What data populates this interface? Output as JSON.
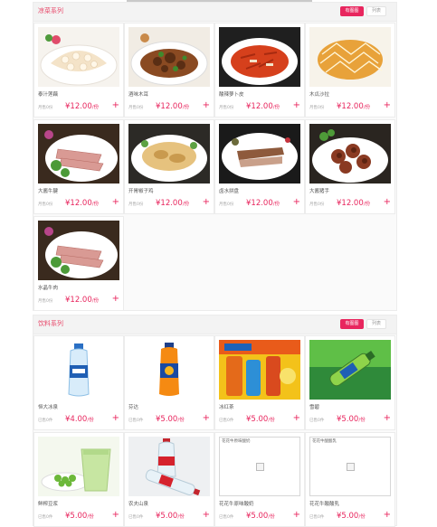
{
  "sections": [
    {
      "title": "凉菜系列",
      "view_image_label": "有图图",
      "view_list_label": "列表",
      "items": [
        {
          "name": "泰汁莲藕",
          "meta": "月售0份",
          "price": "¥12.00",
          "unit": "/份",
          "add": "+",
          "image": "lotus-root-dish"
        },
        {
          "name": "酒味木耳",
          "meta": "月售0份",
          "price": "¥12.00",
          "unit": "/份",
          "add": "+",
          "image": "braised-meat-dish"
        },
        {
          "name": "酸辣萝卜皮",
          "meta": "月售0份",
          "price": "¥12.00",
          "unit": "/份",
          "add": "+",
          "image": "spicy-radish-dish"
        },
        {
          "name": "木瓜沙拉",
          "meta": "月售0份",
          "price": "¥12.00",
          "unit": "/份",
          "add": "+",
          "image": "bread-dish"
        },
        {
          "name": "大酱牛腱",
          "meta": "月售0份",
          "price": "¥12.00",
          "unit": "/份",
          "add": "+",
          "image": "beef-shank-dish"
        },
        {
          "name": "开胃椒子鸡",
          "meta": "月售0份",
          "price": "¥12.00",
          "unit": "/份",
          "add": "+",
          "image": "chicken-dish"
        },
        {
          "name": "卤水拼盘",
          "meta": "月售0份",
          "price": "¥12.00",
          "unit": "/份",
          "add": "+",
          "image": "braised-platter-dish"
        },
        {
          "name": "大酱猪手",
          "meta": "月售0份",
          "price": "¥12.00",
          "unit": "/份",
          "add": "+",
          "image": "pork-knuckle-dish"
        },
        {
          "name": "水晶牛肉",
          "meta": "月售0份",
          "price": "¥12.00",
          "unit": "/份",
          "add": "+",
          "image": "beef-shank-dish"
        }
      ]
    },
    {
      "title": "饮料系列",
      "view_image_label": "有图图",
      "view_list_label": "列表",
      "items": [
        {
          "name": "恒大冰泉",
          "meta": "已售0件",
          "price": "¥4.00",
          "unit": "/份",
          "add": "+",
          "image": "water-bottle"
        },
        {
          "name": "芬达",
          "meta": "已售0件",
          "price": "¥5.00",
          "unit": "/份",
          "add": "+",
          "image": "orange-soda"
        },
        {
          "name": "冰红茶",
          "meta": "已售0件",
          "price": "¥5.00",
          "unit": "/份",
          "add": "+",
          "image": "ice-tea-ad"
        },
        {
          "name": "雪碧",
          "meta": "已售0件",
          "price": "¥5.00",
          "unit": "/份",
          "add": "+",
          "image": "sprite-bottle"
        },
        {
          "name": "鲜榨豆浆",
          "meta": "已售0件",
          "price": "¥5.00",
          "unit": "/份",
          "add": "+",
          "image": "pea-juice"
        },
        {
          "name": "农夫山泉",
          "meta": "已售0件",
          "price": "¥5.00",
          "unit": "/份",
          "add": "+",
          "image": "water-bottles-lying"
        },
        {
          "name": "花花牛原味酸奶",
          "meta": "已售0件",
          "price": "¥5.00",
          "unit": "/份",
          "add": "+",
          "image": "missing",
          "image_alt": "花花牛原味酸奶"
        },
        {
          "name": "花花牛酸酸乳",
          "meta": "已售0件",
          "price": "¥5.00",
          "unit": "/份",
          "add": "+",
          "image": "missing",
          "image_alt": "花花牛酸酸乳"
        }
      ]
    }
  ],
  "colors": {
    "accent": "#e8265e",
    "title": "#e8486a"
  }
}
